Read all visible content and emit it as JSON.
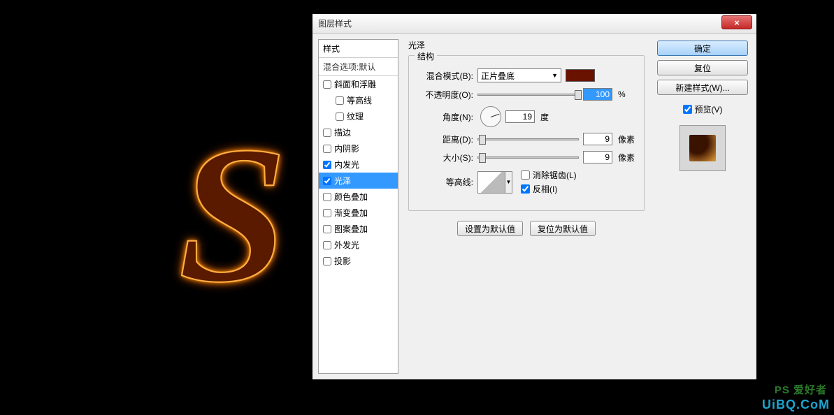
{
  "canvas_letter": "S",
  "dialog": {
    "title": "图层样式",
    "close_icon": "×"
  },
  "styles_panel": {
    "header": "样式",
    "blend_options": "混合选项:默认",
    "items": [
      {
        "label": "斜面和浮雕",
        "checked": false,
        "indent": false
      },
      {
        "label": "等高线",
        "checked": false,
        "indent": true
      },
      {
        "label": "纹理",
        "checked": false,
        "indent": true
      },
      {
        "label": "描边",
        "checked": false,
        "indent": false
      },
      {
        "label": "内阴影",
        "checked": false,
        "indent": false
      },
      {
        "label": "内发光",
        "checked": true,
        "indent": false
      },
      {
        "label": "光泽",
        "checked": true,
        "indent": false,
        "selected": true
      },
      {
        "label": "颜色叠加",
        "checked": false,
        "indent": false
      },
      {
        "label": "渐变叠加",
        "checked": false,
        "indent": false
      },
      {
        "label": "图案叠加",
        "checked": false,
        "indent": false
      },
      {
        "label": "外发光",
        "checked": false,
        "indent": false
      },
      {
        "label": "投影",
        "checked": false,
        "indent": false
      }
    ]
  },
  "settings": {
    "section_title": "光泽",
    "group_title": "结构",
    "blend_mode_label": "混合模式(B):",
    "blend_mode_value": "正片叠底",
    "color": "#6a1200",
    "opacity_label": "不透明度(O):",
    "opacity_value": "100",
    "opacity_unit": "%",
    "angle_label": "角度(N):",
    "angle_value": "19",
    "angle_unit": "度",
    "distance_label": "距离(D):",
    "distance_value": "9",
    "distance_unit": "像素",
    "size_label": "大小(S):",
    "size_value": "9",
    "size_unit": "像素",
    "contour_label": "等高线:",
    "antialias_label": "消除锯齿(L)",
    "antialias_checked": false,
    "invert_label": "反相(I)",
    "invert_checked": true,
    "set_default": "设置为默认值",
    "reset_default": "复位为默认值"
  },
  "buttons": {
    "ok": "确定",
    "cancel": "复位",
    "new_style": "新建样式(W)...",
    "preview": "预览(V)",
    "preview_checked": true
  },
  "watermark": {
    "line1": "PS 爱好者",
    "line2": "UiBQ.CoM"
  },
  "chart_data": null
}
